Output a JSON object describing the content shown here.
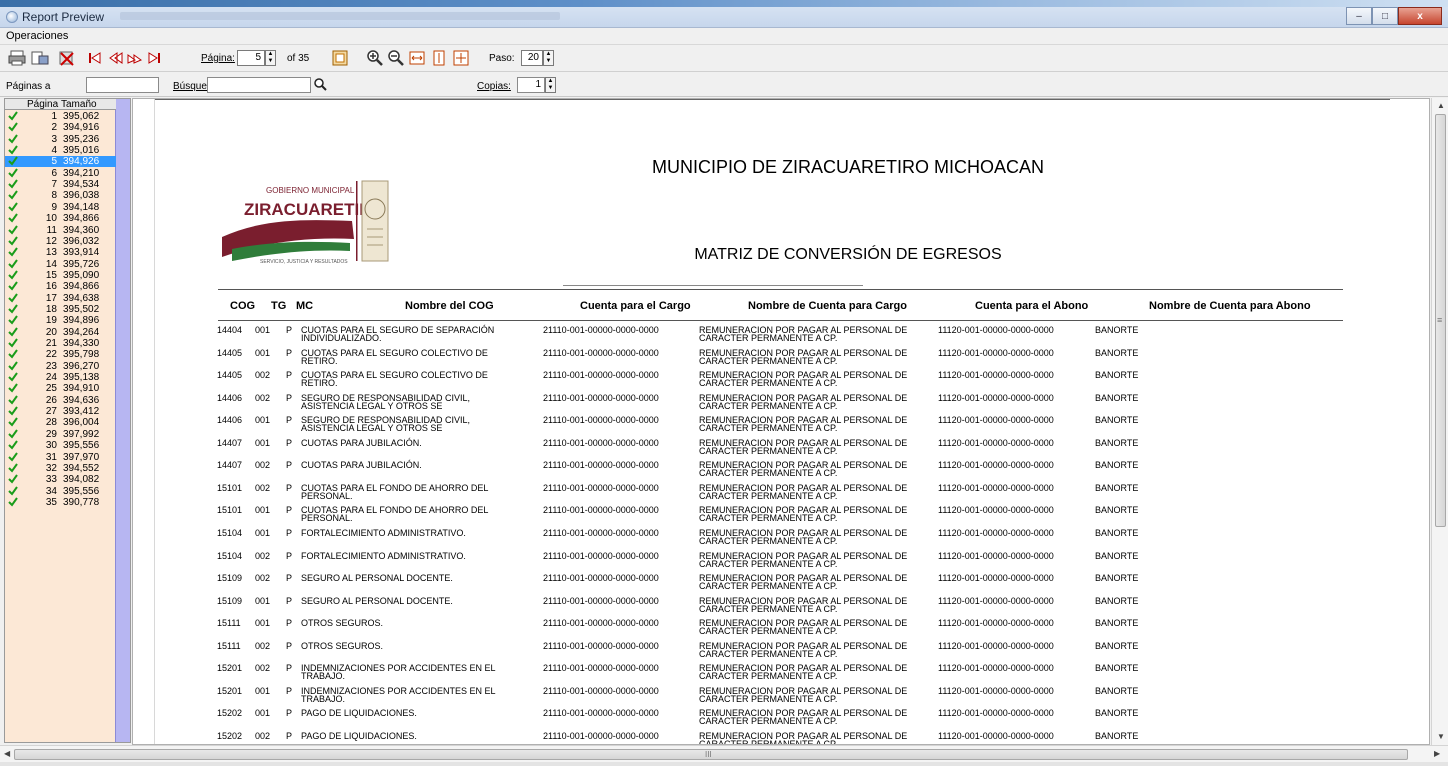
{
  "window": {
    "title": "Report Preview",
    "minimize": "–",
    "maximize": "□",
    "close": "x"
  },
  "menu": {
    "operaciones": "Operaciones"
  },
  "toolbar": {
    "pagina_label": "Página:",
    "pagina_value": "5",
    "of_label": "of 35",
    "paso_label": "Paso:",
    "paso_value": "20"
  },
  "search": {
    "paginas_label": "Páginas a",
    "paginas_value": "",
    "busqueda_label": "Búsqued",
    "busqueda_value": "",
    "copias_label": "Copias:",
    "copias_value": "1"
  },
  "page_list": {
    "col_pagina": "Página",
    "col_tamano": "Tamaño",
    "selected": "5",
    "rows": [
      {
        "n": "1",
        "size": "395,062"
      },
      {
        "n": "2",
        "size": "394,916"
      },
      {
        "n": "3",
        "size": "395,236"
      },
      {
        "n": "4",
        "size": "395,016"
      },
      {
        "n": "5",
        "size": "394,926"
      },
      {
        "n": "6",
        "size": "394,210"
      },
      {
        "n": "7",
        "size": "394,534"
      },
      {
        "n": "8",
        "size": "396,038"
      },
      {
        "n": "9",
        "size": "394,148"
      },
      {
        "n": "10",
        "size": "394,866"
      },
      {
        "n": "11",
        "size": "394,360"
      },
      {
        "n": "12",
        "size": "396,032"
      },
      {
        "n": "13",
        "size": "393,914"
      },
      {
        "n": "14",
        "size": "395,726"
      },
      {
        "n": "15",
        "size": "395,090"
      },
      {
        "n": "16",
        "size": "394,866"
      },
      {
        "n": "17",
        "size": "394,638"
      },
      {
        "n": "18",
        "size": "395,502"
      },
      {
        "n": "19",
        "size": "394,896"
      },
      {
        "n": "20",
        "size": "394,264"
      },
      {
        "n": "21",
        "size": "394,330"
      },
      {
        "n": "22",
        "size": "395,798"
      },
      {
        "n": "23",
        "size": "396,270"
      },
      {
        "n": "24",
        "size": "395,138"
      },
      {
        "n": "25",
        "size": "394,910"
      },
      {
        "n": "26",
        "size": "394,636"
      },
      {
        "n": "27",
        "size": "393,412"
      },
      {
        "n": "28",
        "size": "396,004"
      },
      {
        "n": "29",
        "size": "397,992"
      },
      {
        "n": "30",
        "size": "395,556"
      },
      {
        "n": "31",
        "size": "397,970"
      },
      {
        "n": "32",
        "size": "394,552"
      },
      {
        "n": "33",
        "size": "394,082"
      },
      {
        "n": "34",
        "size": "395,556"
      },
      {
        "n": "35",
        "size": "390,778"
      }
    ]
  },
  "report": {
    "org_title": "MUNICIPIO DE ZIRACUARETIRO MICHOACAN",
    "report_title": "MATRIZ DE CONVERSIÓN DE EGRESOS",
    "logo_top": "GOBIERNO MUNICIPAL",
    "logo_name": "ZIRACUARETIRO",
    "logo_tagline": "SERVICIO, JUSTICIA Y RESULTADOS",
    "headers": {
      "cog": "COG",
      "tg": "TG",
      "mc": "MC",
      "nombre_cog": "Nombre del COG",
      "cuenta_cargo": "Cuenta para el Cargo",
      "nombre_cargo": "Nombre de Cuenta para Cargo",
      "cuenta_abono": "Cuenta para el Abono",
      "nombre_abono": "Nombre de Cuenta para Abono"
    },
    "rows": [
      {
        "cog": "14404",
        "tg": "001",
        "mc": "P",
        "nombre1": "CUOTAS PARA EL SEGURO DE SEPARACIÓN",
        "nombre2": "INDIVIDUALIZADO.",
        "cargo": "21110-001-00000-0000-0000",
        "ncargo1": "REMUNERACION POR PAGAR  AL PERSONAL DE",
        "ncargo2": "CARACTER PERMANENTE A CP.",
        "abono": "11120-001-00000-0000-0000",
        "nabono": "BANORTE"
      },
      {
        "cog": "14405",
        "tg": "001",
        "mc": "P",
        "nombre1": "CUOTAS PARA EL SEGURO COLECTIVO DE",
        "nombre2": "RETIRO.",
        "cargo": "21110-001-00000-0000-0000",
        "ncargo1": "REMUNERACION POR PAGAR  AL PERSONAL DE",
        "ncargo2": "CARACTER PERMANENTE A CP.",
        "abono": "11120-001-00000-0000-0000",
        "nabono": "BANORTE"
      },
      {
        "cog": "14405",
        "tg": "002",
        "mc": "P",
        "nombre1": "CUOTAS PARA EL SEGURO COLECTIVO DE",
        "nombre2": "RETIRO.",
        "cargo": "21110-001-00000-0000-0000",
        "ncargo1": "REMUNERACION POR PAGAR  AL PERSONAL DE",
        "ncargo2": "CARACTER PERMANENTE A CP.",
        "abono": "11120-001-00000-0000-0000",
        "nabono": "BANORTE"
      },
      {
        "cog": "14406",
        "tg": "002",
        "mc": "P",
        "nombre1": "SEGURO DE RESPONSABILIDAD CIVIL,",
        "nombre2": "ASISTENCIA LEGAL Y OTROS SE",
        "cargo": "21110-001-00000-0000-0000",
        "ncargo1": "REMUNERACION POR PAGAR  AL PERSONAL DE",
        "ncargo2": "CARACTER PERMANENTE A CP.",
        "abono": "11120-001-00000-0000-0000",
        "nabono": "BANORTE"
      },
      {
        "cog": "14406",
        "tg": "001",
        "mc": "P",
        "nombre1": "SEGURO DE RESPONSABILIDAD CIVIL,",
        "nombre2": "ASISTENCIA LEGAL Y OTROS SE",
        "cargo": "21110-001-00000-0000-0000",
        "ncargo1": "REMUNERACION POR PAGAR  AL PERSONAL DE",
        "ncargo2": "CARACTER PERMANENTE A CP.",
        "abono": "11120-001-00000-0000-0000",
        "nabono": "BANORTE"
      },
      {
        "cog": "14407",
        "tg": "001",
        "mc": "P",
        "nombre1": "CUOTAS PARA JUBILACIÓN.",
        "nombre2": "",
        "cargo": "21110-001-00000-0000-0000",
        "ncargo1": "REMUNERACION POR PAGAR  AL PERSONAL DE",
        "ncargo2": "CARACTER PERMANENTE A CP.",
        "abono": "11120-001-00000-0000-0000",
        "nabono": "BANORTE"
      },
      {
        "cog": "14407",
        "tg": "002",
        "mc": "P",
        "nombre1": "CUOTAS PARA JUBILACIÓN.",
        "nombre2": "",
        "cargo": "21110-001-00000-0000-0000",
        "ncargo1": "REMUNERACION POR PAGAR  AL PERSONAL DE",
        "ncargo2": "CARACTER PERMANENTE A CP.",
        "abono": "11120-001-00000-0000-0000",
        "nabono": "BANORTE"
      },
      {
        "cog": "15101",
        "tg": "002",
        "mc": "P",
        "nombre1": "CUOTAS PARA EL FONDO DE AHORRO DEL",
        "nombre2": "PERSONAL.",
        "cargo": "21110-001-00000-0000-0000",
        "ncargo1": "REMUNERACION POR PAGAR  AL PERSONAL DE",
        "ncargo2": "CARACTER PERMANENTE A CP.",
        "abono": "11120-001-00000-0000-0000",
        "nabono": "BANORTE"
      },
      {
        "cog": "15101",
        "tg": "001",
        "mc": "P",
        "nombre1": "CUOTAS PARA EL FONDO DE AHORRO DEL",
        "nombre2": "PERSONAL.",
        "cargo": "21110-001-00000-0000-0000",
        "ncargo1": "REMUNERACION POR PAGAR  AL PERSONAL DE",
        "ncargo2": "CARACTER PERMANENTE A CP.",
        "abono": "11120-001-00000-0000-0000",
        "nabono": "BANORTE"
      },
      {
        "cog": "15104",
        "tg": "001",
        "mc": "P",
        "nombre1": "FORTALECIMIENTO ADMINISTRATIVO.",
        "nombre2": "",
        "cargo": "21110-001-00000-0000-0000",
        "ncargo1": "REMUNERACION POR PAGAR  AL PERSONAL DE",
        "ncargo2": "CARACTER PERMANENTE A CP.",
        "abono": "11120-001-00000-0000-0000",
        "nabono": "BANORTE"
      },
      {
        "cog": "15104",
        "tg": "002",
        "mc": "P",
        "nombre1": "FORTALECIMIENTO ADMINISTRATIVO.",
        "nombre2": "",
        "cargo": "21110-001-00000-0000-0000",
        "ncargo1": "REMUNERACION POR PAGAR  AL PERSONAL DE",
        "ncargo2": "CARACTER PERMANENTE A CP.",
        "abono": "11120-001-00000-0000-0000",
        "nabono": "BANORTE"
      },
      {
        "cog": "15109",
        "tg": "002",
        "mc": "P",
        "nombre1": "SEGURO AL PERSONAL DOCENTE.",
        "nombre2": "",
        "cargo": "21110-001-00000-0000-0000",
        "ncargo1": "REMUNERACION POR PAGAR  AL PERSONAL DE",
        "ncargo2": "CARACTER PERMANENTE A CP.",
        "abono": "11120-001-00000-0000-0000",
        "nabono": "BANORTE"
      },
      {
        "cog": "15109",
        "tg": "001",
        "mc": "P",
        "nombre1": "SEGURO AL PERSONAL DOCENTE.",
        "nombre2": "",
        "cargo": "21110-001-00000-0000-0000",
        "ncargo1": "REMUNERACION POR PAGAR  AL PERSONAL DE",
        "ncargo2": "CARACTER PERMANENTE A CP.",
        "abono": "11120-001-00000-0000-0000",
        "nabono": "BANORTE"
      },
      {
        "cog": "15111",
        "tg": "001",
        "mc": "P",
        "nombre1": "OTROS SEGUROS.",
        "nombre2": "",
        "cargo": "21110-001-00000-0000-0000",
        "ncargo1": "REMUNERACION POR PAGAR  AL PERSONAL DE",
        "ncargo2": "CARACTER PERMANENTE A CP.",
        "abono": "11120-001-00000-0000-0000",
        "nabono": "BANORTE"
      },
      {
        "cog": "15111",
        "tg": "002",
        "mc": "P",
        "nombre1": "OTROS SEGUROS.",
        "nombre2": "",
        "cargo": "21110-001-00000-0000-0000",
        "ncargo1": "REMUNERACION POR PAGAR  AL PERSONAL DE",
        "ncargo2": "CARACTER PERMANENTE A CP.",
        "abono": "11120-001-00000-0000-0000",
        "nabono": "BANORTE"
      },
      {
        "cog": "15201",
        "tg": "002",
        "mc": "P",
        "nombre1": "INDEMNIZACIONES POR ACCIDENTES EN EL",
        "nombre2": "TRABAJO.",
        "cargo": "21110-001-00000-0000-0000",
        "ncargo1": "REMUNERACION POR PAGAR  AL PERSONAL DE",
        "ncargo2": "CARACTER PERMANENTE A CP.",
        "abono": "11120-001-00000-0000-0000",
        "nabono": "BANORTE"
      },
      {
        "cog": "15201",
        "tg": "001",
        "mc": "P",
        "nombre1": "INDEMNIZACIONES POR ACCIDENTES EN EL",
        "nombre2": "TRABAJO.",
        "cargo": "21110-001-00000-0000-0000",
        "ncargo1": "REMUNERACION POR PAGAR  AL PERSONAL DE",
        "ncargo2": "CARACTER PERMANENTE A CP.",
        "abono": "11120-001-00000-0000-0000",
        "nabono": "BANORTE"
      },
      {
        "cog": "15202",
        "tg": "001",
        "mc": "P",
        "nombre1": "PAGO DE LIQUIDACIONES.",
        "nombre2": "",
        "cargo": "21110-001-00000-0000-0000",
        "ncargo1": "REMUNERACION POR PAGAR  AL PERSONAL DE",
        "ncargo2": "CARACTER PERMANENTE A CP.",
        "abono": "11120-001-00000-0000-0000",
        "nabono": "BANORTE"
      },
      {
        "cog": "15202",
        "tg": "002",
        "mc": "P",
        "nombre1": "PAGO DE LIQUIDACIONES.",
        "nombre2": "",
        "cargo": "21110-001-00000-0000-0000",
        "ncargo1": "REMUNERACION POR PAGAR  AL PERSONAL DE",
        "ncargo2": "CARACTER PERMANENTE A CP.",
        "abono": "11120-001-00000-0000-0000",
        "nabono": "BANORTE"
      }
    ]
  },
  "scroll": {
    "hgrip": "III",
    "vgrip": "≡"
  }
}
